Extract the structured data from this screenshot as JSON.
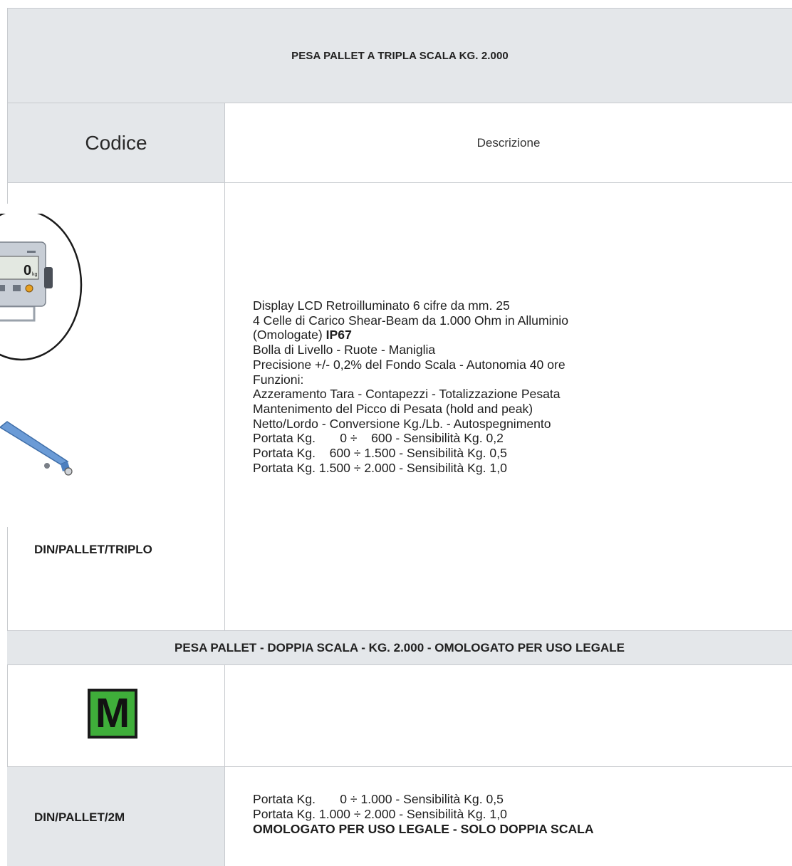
{
  "section1": {
    "title": "PESA PALLET A TRIPLA SCALA KG. 2.000",
    "header_code": "Codice",
    "header_description": "Descrizione",
    "code": "DIN/PALLET/TRIPLO",
    "description_lines": [
      "Display LCD Retroilluminato 6 cifre da mm. 25",
      "4 Celle di Carico Shear-Beam da 1.000 Ohm in Alluminio",
      "Bolla di Livello - Ruote - Maniglia",
      "Precisione +/- 0,2% del Fondo Scala - Autonomia 40 ore",
      "Funzioni:",
      "Azzeramento Tara - Contapezzi - Totalizzazione Pesata",
      "Mantenimento del Picco di Pesata (hold and peak)",
      "Netto/Lordo - Conversione Kg./Lb. - Autospegnimento",
      "Portata Kg.       0 ÷    600 - Sensibilità Kg. 0,2",
      "Portata Kg.    600 ÷ 1.500 - Sensibilità Kg. 0,5",
      "Portata Kg. 1.500 ÷ 2.000 - Sensibilità Kg. 1,0"
    ],
    "omologate_text": "(Omologate) ",
    "ip_rating": "IP67",
    "display_reading": "0",
    "display_unit": "kg"
  },
  "section2": {
    "title": "PESA PALLET - DOPPIA SCALA - KG. 2.000 - OMOLOGATO PER USO LEGALE",
    "badge_letter": "M",
    "code": "DIN/PALLET/2M",
    "description_lines": [
      "Portata Kg.       0 ÷ 1.000 - Sensibilità Kg. 0,5",
      "Portata Kg. 1.000 ÷ 2.000 - Sensibilità Kg. 1,0"
    ],
    "description_bold": "OMOLOGATO PER USO LEGALE - SOLO DOPPIA SCALA"
  },
  "colors": {
    "header_bg": "#e4e7ea",
    "border": "#c8cbcf",
    "badge_green": "#3fae3a",
    "pallet_blue": "#6b9bd6"
  }
}
